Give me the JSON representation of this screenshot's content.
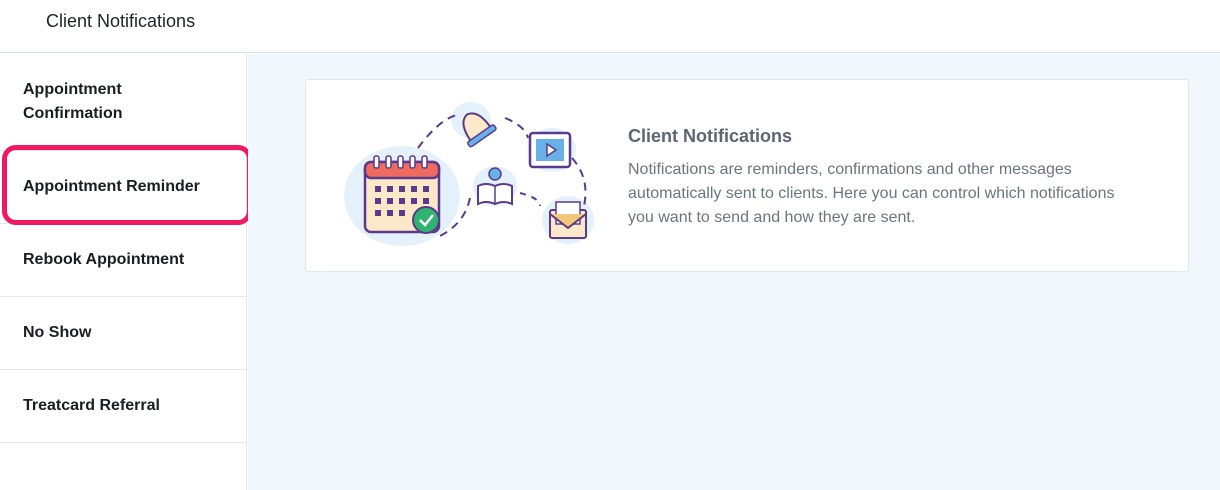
{
  "header": {
    "title": "Client Notifications"
  },
  "sidebar": {
    "items": [
      {
        "label": "Appointment\nConfirmation"
      },
      {
        "label": "Appointment Reminder"
      },
      {
        "label": "Rebook Appointment"
      },
      {
        "label": "No Show"
      },
      {
        "label": "Treatcard Referral"
      }
    ]
  },
  "info_card": {
    "title": "Client Notifications",
    "description": "Notifications are reminders, confirmations and other messages automatically sent to clients. Here you can control which notifications you want to send and how they are sent.",
    "illustration": "notifications-illustration"
  },
  "colors": {
    "highlight": "#f0185e",
    "main_bg": "#f0f7fd",
    "accent_purple": "#5a3a8c",
    "calendar_red": "#f06b5f",
    "check_green": "#2fb36e"
  }
}
